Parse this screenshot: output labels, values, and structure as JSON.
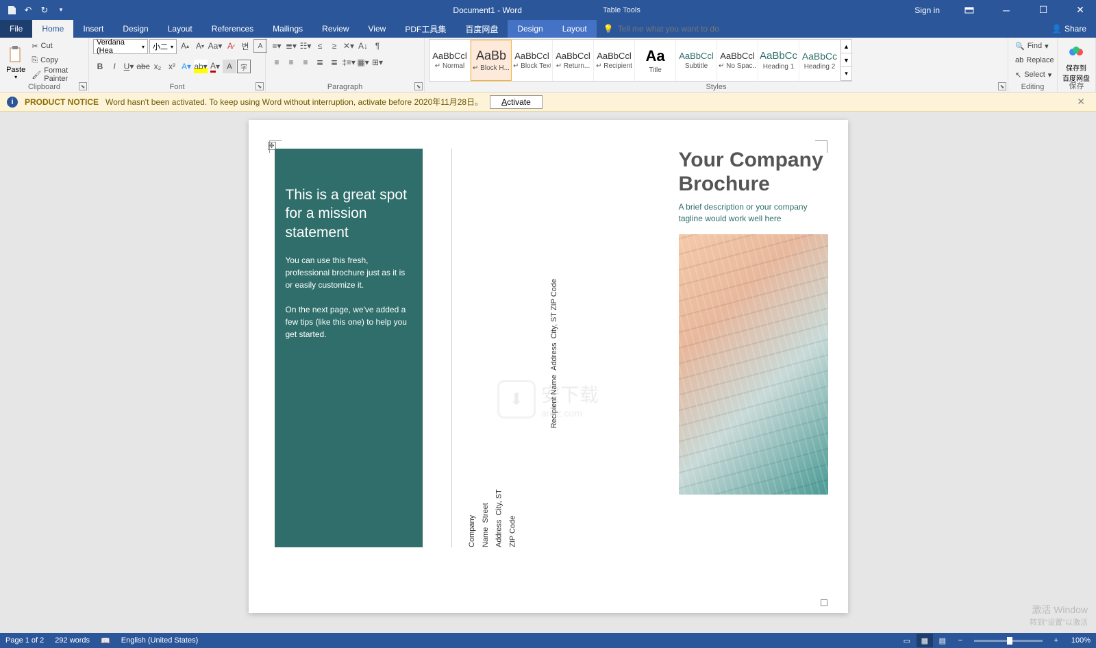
{
  "titlebar": {
    "doc_title": "Document1 - Word",
    "table_tools": "Table Tools",
    "signin": "Sign in"
  },
  "tabs": {
    "file": "File",
    "home": "Home",
    "insert": "Insert",
    "design": "Design",
    "layout": "Layout",
    "references": "References",
    "mailings": "Mailings",
    "review": "Review",
    "view": "View",
    "pdf": "PDF工具集",
    "baidu": "百度网盘",
    "ctx_design": "Design",
    "ctx_layout": "Layout",
    "tellme_placeholder": "Tell me what you want to do",
    "share": "Share"
  },
  "ribbon": {
    "clipboard": {
      "label": "Clipboard",
      "paste": "Paste",
      "cut": "Cut",
      "copy": "Copy",
      "fmtpainter": "Format Painter"
    },
    "font": {
      "label": "Font",
      "name": "Verdana (Hea",
      "size": "小二"
    },
    "paragraph": {
      "label": "Paragraph"
    },
    "styles": {
      "label": "Styles",
      "items": [
        {
          "prev": "AaBbCcl",
          "name": "↵ Normal"
        },
        {
          "prev": "AaBb",
          "name": "↵ Block H..."
        },
        {
          "prev": "AaBbCcl",
          "name": "↵ Block Text"
        },
        {
          "prev": "AaBbCcl",
          "name": "↵ Return..."
        },
        {
          "prev": "AaBbCcl",
          "name": "↵ Recipient"
        },
        {
          "prev": "Aa",
          "name": "Title"
        },
        {
          "prev": "AaBbCcl",
          "name": "Subtitle"
        },
        {
          "prev": "AaBbCcl",
          "name": "↵ No Spac..."
        },
        {
          "prev": "AaBbCc",
          "name": "Heading 1"
        },
        {
          "prev": "AaBbCc",
          "name": "Heading 2"
        }
      ]
    },
    "editing": {
      "label": "Editing",
      "find": "Find",
      "replace": "Replace",
      "select": "Select"
    },
    "baidu": {
      "label": "保存",
      "line1": "保存到",
      "line2": "百度网盘"
    }
  },
  "notice": {
    "title": "PRODUCT NOTICE",
    "msg": "Word hasn't been activated. To keep using Word without interruption, activate before 2020年11月28日。",
    "activate": "Activate"
  },
  "doc": {
    "mission_h": "This is a great spot for a mission statement",
    "mission_p1": "You can use this fresh, professional brochure just as it is or easily customize it.",
    "mission_p2": "On the next page, we've added a few tips (like this one) to help you get started.",
    "recip_name": "Recipient Name",
    "recip_addr": "Address",
    "recip_city": "City, ST  ZIP Code",
    "comp_name": "Company Name",
    "comp_addr": "Street Address",
    "comp_city": "City, ST  ZIP Code",
    "brochure_title": "Your Company Brochure",
    "tagline": "A brief description or your company tagline would work well here"
  },
  "watermark": {
    "text": "安下载",
    "sub": "anxz.com"
  },
  "status": {
    "page": "Page 1 of 2",
    "words": "292 words",
    "lang": "English (United States)",
    "zoom": "100%"
  },
  "activation": {
    "l1": "激活 Window",
    "l2": "转到\"设置\"以激活"
  }
}
